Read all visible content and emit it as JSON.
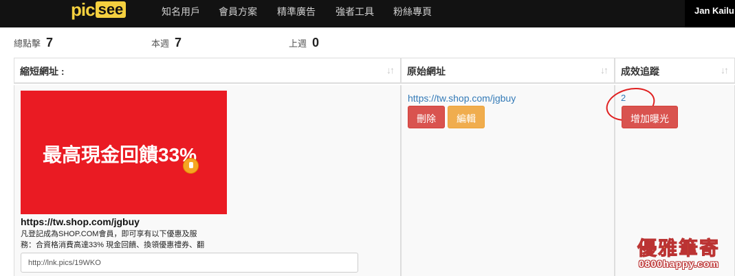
{
  "header": {
    "logo": {
      "pic": "pic",
      "see": "see"
    },
    "nav": [
      "知名用戶",
      "會員方案",
      "精準廣告",
      "強者工具",
      "粉絲專頁"
    ],
    "user_name": "Jan Kailu"
  },
  "stats": [
    {
      "label": "總點擊",
      "value": "7"
    },
    {
      "label": "本週",
      "value": "7"
    },
    {
      "label": "上週",
      "value": "0"
    }
  ],
  "table": {
    "columns": [
      "縮短網址 :",
      "原始網址",
      "成效追蹤"
    ],
    "sort_icon": "↓↑",
    "row": {
      "banner_text": "最高現金回饋33%",
      "short_title": "https://tw.shop.com/jgbuy",
      "description_line1": "凡登記成為SHOP.COM會員，即可享有以下優惠及服",
      "description_line2": "務：合資格消費高達33% 現金回饋、換領優惠禮券、翻",
      "short_link": "http://lnk.pics/19WKO",
      "original_url": "https://tw.shop.com/jgbuy",
      "delete_label": "刪除",
      "edit_label": "編輯",
      "clicks": "2",
      "boost_label": "增加曝光"
    }
  },
  "watermark": {
    "title": "優雅筆寄",
    "site": "0800happy.com"
  },
  "colors": {
    "topbar": "#121212",
    "logo": "#f4d03f",
    "danger": "#d9534f",
    "warning": "#f0ad4e",
    "link": "#337ab7",
    "banner": "#ea1b23"
  }
}
